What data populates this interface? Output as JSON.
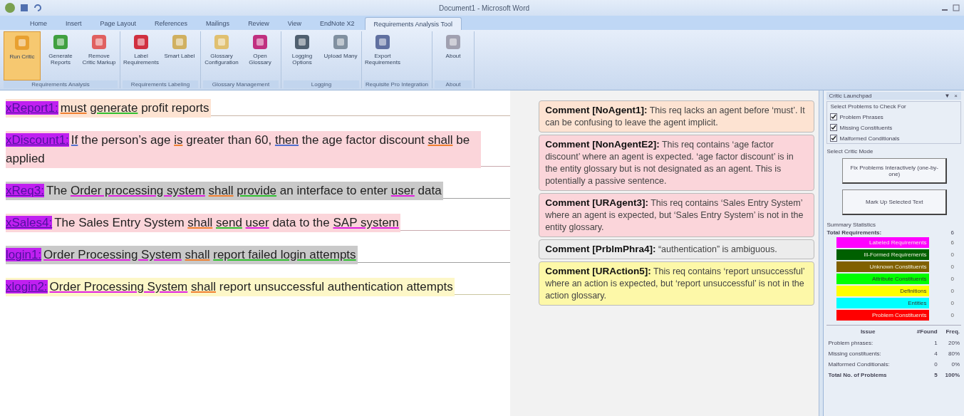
{
  "window": {
    "title": "Document1 - Microsoft Word"
  },
  "tabs": [
    {
      "label": "Home",
      "selected": false
    },
    {
      "label": "Insert",
      "selected": false
    },
    {
      "label": "Page Layout",
      "selected": false
    },
    {
      "label": "References",
      "selected": false
    },
    {
      "label": "Mailings",
      "selected": false
    },
    {
      "label": "Review",
      "selected": false
    },
    {
      "label": "View",
      "selected": false
    },
    {
      "label": "EndNote X2",
      "selected": false
    },
    {
      "label": "Requirements Analysis Tool",
      "selected": true
    }
  ],
  "ribbon_groups": [
    {
      "label": "Requirements Analysis",
      "buttons": [
        {
          "label": "Run Critic",
          "selected": true
        },
        {
          "label": "Generate Reports",
          "selected": false
        },
        {
          "label": "Remove Critic Markup",
          "selected": false
        }
      ]
    },
    {
      "label": "Requirements Labeling",
      "buttons": [
        {
          "label": "Label Requirements",
          "selected": false
        },
        {
          "label": "Smart Label",
          "selected": false
        }
      ]
    },
    {
      "label": "Glossary Management",
      "buttons": [
        {
          "label": "Glossary Configuration",
          "selected": false
        },
        {
          "label": "Open Glossary",
          "selected": false
        }
      ]
    },
    {
      "label": "Logging",
      "buttons": [
        {
          "label": "Logging Options",
          "selected": false
        },
        {
          "label": "Upload Many",
          "selected": false
        }
      ]
    },
    {
      "label": "Requisite Pro Integration",
      "buttons": [
        {
          "label": "Export Requirements",
          "selected": false
        }
      ]
    },
    {
      "label": "About",
      "buttons": [
        {
          "label": "About",
          "selected": false
        }
      ]
    }
  ],
  "requirements": [
    {
      "label": "xReport1:",
      "color": "#fde3d2",
      "segments": [
        {
          "text": "must",
          "kind": "modal"
        },
        {
          "text": "generate",
          "kind": "action"
        },
        {
          "text": "profit reports"
        }
      ]
    },
    {
      "label": "xDiscount1:",
      "color": "#fbd5da",
      "segments": [
        {
          "text": "If",
          "kind": "condition"
        },
        {
          "text": "the person’s age"
        },
        {
          "text": "is",
          "kind": "modal"
        },
        {
          "text": "greater than 60,"
        },
        {
          "text": "then",
          "kind": "condition"
        },
        {
          "text": "the age factor discount"
        },
        {
          "text": "shall",
          "kind": "modal"
        },
        {
          "text": "be applied"
        }
      ]
    },
    {
      "label": "xReq3:",
      "color": "#c9c9c9",
      "segments": [
        {
          "text": "The"
        },
        {
          "text": "Order processing system",
          "kind": "agent"
        },
        {
          "text": "shall",
          "kind": "modal"
        },
        {
          "text": "provide",
          "kind": "action"
        },
        {
          "text": "an interface to enter"
        },
        {
          "text": "user",
          "kind": "agent"
        },
        {
          "text": "data"
        }
      ]
    },
    {
      "label": "xSales4:",
      "color": "#fbd5da",
      "segments": [
        {
          "text": "The Sales Entry System"
        },
        {
          "text": "shall",
          "kind": "modal"
        },
        {
          "text": "send",
          "kind": "action"
        },
        {
          "text": "user",
          "kind": "agent"
        },
        {
          "text": "data to the"
        },
        {
          "text": "SAP system",
          "kind": "agent"
        }
      ]
    },
    {
      "label": "login1:",
      "color": "#c9c9c9",
      "segments": [
        {
          "text": "Order Processing System",
          "kind": "agent"
        },
        {
          "text": "shall",
          "kind": "modal"
        },
        {
          "text": "report failed login attempts",
          "kind": "action"
        }
      ]
    },
    {
      "label": "xlogin2:",
      "color": "#fdf7c8",
      "segments": [
        {
          "text": "Order Processing System",
          "kind": "agent"
        },
        {
          "text": "shall",
          "kind": "modal"
        },
        {
          "text": "report unsuccessful authentication attempts"
        }
      ]
    }
  ],
  "comments": [
    {
      "text": "**Comment [NoAgent1]:** This req lacks an agent before ‘must’. It can be confusing to leave the agent implicit.",
      "color": "#fde3d2"
    },
    {
      "text": "**Comment [NonAgentE2]:** This req contains ‘age factor discount’ where an agent is expected. ‘age factor discount’ is in the entity glossary but is not designated as an agent. This is potentially a passive sentence.",
      "color": "#fbd5da"
    },
    {
      "text": "**Comment [URAgent3]:** This req contains ‘Sales Entry System’ where an agent is expected, but ‘Sales Entry System’ is not in the entity glossary.",
      "color": "#fbd5da"
    },
    {
      "text": "**Comment [PrblmPhra4]:** “authentication” is ambiguous.",
      "color": "#ececec"
    },
    {
      "text": "**Comment [URAction5]:** This req contains ‘report unsuccessful’ where an action is expected, but ‘report unsuccessful’ is not in the action glossary.",
      "color": "#fdf8a8"
    }
  ],
  "pane": {
    "title": "Critic Launchpad",
    "menu": "▼",
    "close": "×",
    "check_group": "Select Problems to Check For",
    "checks": [
      {
        "label": "Problem Phrases",
        "checked": true
      },
      {
        "label": "Missing Constituents",
        "checked": true
      },
      {
        "label": "Malformed Conditionals",
        "checked": true
      }
    ],
    "mode_group": "Select Critic Mode",
    "mode_buttons": [
      "Fix Problems Interactively (one-by-one)",
      "Mark Up Selected Text"
    ],
    "stats_title": "Summary Statistics",
    "total_label": "Total Requirements:",
    "total_value": "6",
    "legend": [
      {
        "label": "Labeled Requirements",
        "value": "6",
        "color": "#ff00ff"
      },
      {
        "label": "Ill-Formed Requirements",
        "value": "0",
        "color": "#006000"
      },
      {
        "label": "Unknown Constituents",
        "value": "0",
        "color": "#806000"
      },
      {
        "label": "Attribute Constituents",
        "value": "0",
        "color": "#00ff00"
      },
      {
        "label": "Definitions",
        "value": "0",
        "color": "#ffff00"
      },
      {
        "label": "Entities",
        "value": "0",
        "color": "#00ffff"
      },
      {
        "label": "Problem Constituents",
        "value": "0",
        "color": "#ff0000"
      }
    ],
    "table": {
      "columns": [
        "Issue",
        "#Found",
        "Freq."
      ],
      "rows": [
        [
          "Problem phrases:",
          "1",
          "20%"
        ],
        [
          "Missing constituents:",
          "4",
          "80%"
        ],
        [
          "Malformed Conditionals:",
          "0",
          "0%"
        ]
      ],
      "total": [
        "Total No. of Problems",
        "5",
        "100%"
      ]
    }
  }
}
